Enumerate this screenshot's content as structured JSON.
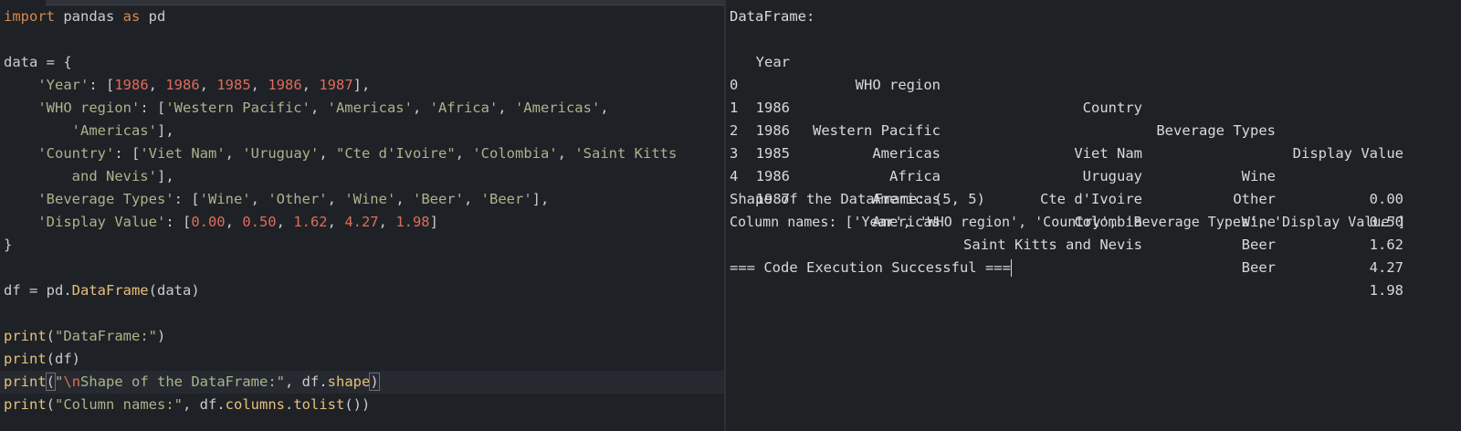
{
  "code": {
    "line1": {
      "kw_import": "import",
      "mod": " pandas ",
      "kw_as": "as",
      "alias": " pd"
    },
    "line3": {
      "text": "data = {"
    },
    "line4": {
      "indent": "    ",
      "key": "'Year'",
      "sep": ": [",
      "n1": "1986",
      "c1": ", ",
      "n2": "1986",
      "c2": ", ",
      "n3": "1985",
      "c3": ", ",
      "n4": "1986",
      "c4": ", ",
      "n5": "1987",
      "end": "],"
    },
    "line5": {
      "indent": "    ",
      "key": "'WHO region'",
      "sep": ": [",
      "s1": "'Western Pacific'",
      "c1": ", ",
      "s2": "'Americas'",
      "c2": ", ",
      "s3": "'Africa'",
      "c3": ", ",
      "s4": "'Americas'",
      "end": ","
    },
    "line6": {
      "indent": "        ",
      "s5": "'Americas'",
      "end": "],"
    },
    "line7": {
      "indent": "    ",
      "key": "'Country'",
      "sep": ": [",
      "s1": "'Viet Nam'",
      "c1": ", ",
      "s2": "'Uruguay'",
      "c2": ", ",
      "s3": "\"Cte d'Ivoire\"",
      "c3": ", ",
      "s4": "'Colombia'",
      "c4": ", ",
      "s5a": "'Saint Kitts"
    },
    "line8": {
      "indent": "        ",
      "s5b": "and Nevis'",
      "end": "],"
    },
    "line9": {
      "indent": "    ",
      "key": "'Beverage Types'",
      "sep": ": [",
      "s1": "'Wine'",
      "c1": ", ",
      "s2": "'Other'",
      "c2": ", ",
      "s3": "'Wine'",
      "c3": ", ",
      "s4": "'Beer'",
      "c4": ", ",
      "s5": "'Beer'",
      "end": "],"
    },
    "line10": {
      "indent": "    ",
      "key": "'Display Value'",
      "sep": ": [",
      "n1": "0.00",
      "c1": ", ",
      "n2": "0.50",
      "c2": ", ",
      "n3": "1.62",
      "c3": ", ",
      "n4": "4.27",
      "c4": ", ",
      "n5": "1.98",
      "end": "]"
    },
    "line11": {
      "text": "}"
    },
    "line13": {
      "pre": "df = pd.",
      "cls": "DataFrame",
      "post": "(data)"
    },
    "line15": {
      "fn": "print",
      "open": "(",
      "str": "\"DataFrame:\"",
      "close": ")"
    },
    "line16": {
      "fn": "print",
      "rest": "(df)"
    },
    "line17": {
      "fn": "print",
      "open": "(",
      "q": "\"",
      "esc": "\\n",
      "str": "Shape of the DataFrame:\"",
      "mid": ", df.",
      "attr": "shape",
      "close": ")"
    },
    "line18": {
      "fn": "print",
      "open": "(",
      "str": "\"Column names:\"",
      "mid": ", df.",
      "attr1": "columns",
      "dot": ".",
      "attr2": "tolist",
      "close": "())"
    }
  },
  "output": {
    "header_label": "DataFrame:",
    "columns": [
      "Year",
      "WHO region",
      "Country",
      "Beverage Types",
      "Display Value"
    ],
    "rows": [
      {
        "idx": "0",
        "year": "1986",
        "region": "Western Pacific",
        "country": "Viet Nam",
        "bev": "Wine",
        "val": "0.00"
      },
      {
        "idx": "1",
        "year": "1986",
        "region": "Americas",
        "country": "Uruguay",
        "bev": "Other",
        "val": "0.50"
      },
      {
        "idx": "2",
        "year": "1985",
        "region": "Africa",
        "country": "Cte d'Ivoire",
        "bev": "Wine",
        "val": "1.62"
      },
      {
        "idx": "3",
        "year": "1986",
        "region": "Americas",
        "country": "Colombia",
        "bev": "Beer",
        "val": "4.27"
      },
      {
        "idx": "4",
        "year": "1987",
        "region": "Americas",
        "country": "Saint Kitts and Nevis",
        "bev": "Beer",
        "val": "1.98"
      }
    ],
    "shape_line": "Shape of the DataFrame: (5, 5)",
    "columns_line": "Column names: ['Year', 'WHO region', 'Country', 'Beverage Types', 'Display Value']",
    "success_line": "=== Code Execution Successful ==="
  }
}
